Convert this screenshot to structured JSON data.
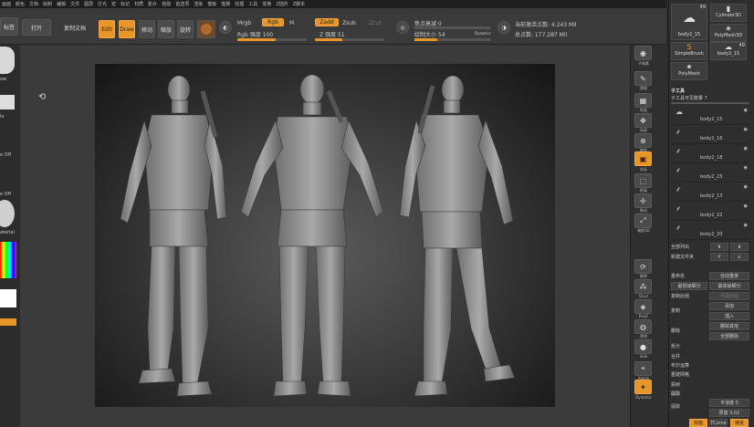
{
  "menu": [
    "画面",
    "颜色",
    "文档",
    "绘制",
    "编辑",
    "文件",
    "图层",
    "灯光",
    "宏",
    "标记",
    "材质",
    "影片",
    "拾取",
    "首选项",
    "渲染",
    "模板",
    "笔刷",
    "纹理",
    "工具",
    "变换",
    "Z插件",
    "Z脚本"
  ],
  "top": {
    "btn_a": "标签",
    "btn_open": "打开",
    "btn_doc": "复制文档",
    "btn_lightbox": "视图布局",
    "mode_edit": "Edit",
    "mode_draw": "Draw",
    "mode_move": "移动",
    "mode_scale": "缩放",
    "mode_rotate": "旋转",
    "mrgb": "Mrgb",
    "rgb": "Rgb",
    "m": "M",
    "rgb_intensity": "Rgb 强度 100",
    "zadd": "Zadd",
    "zsub": "Zsub",
    "zcut": "Zcut",
    "z_intensity": "Z 强度 51",
    "focal_shift": "焦点衰减 0",
    "draw_size": "绘制大小 54",
    "dynamic": "Dynamic",
    "active_points": "当前激活点数: 4.243 Mil",
    "total_points": "总点数: 177.287 Mil",
    "rgb_level": 0.55,
    "z_level": 0.4,
    "draw_level": 0.3
  },
  "left": {
    "label_a": "ow",
    "label_b": "ts",
    "label_c": "e Off",
    "label_d": "e Off",
    "label_e": "aterial"
  },
  "right_tools": [
    {
      "icon": "sphere-icon",
      "label": "子像素"
    },
    {
      "icon": "brush-icon",
      "label": "透视"
    },
    {
      "icon": "grid-icon",
      "label": "地面"
    },
    {
      "icon": "scroll-icon",
      "label": "局部"
    },
    {
      "icon": "zoom-icon",
      "label": "缩放"
    },
    {
      "icon": "actual-icon",
      "label": "实际"
    },
    {
      "icon": "frame-icon",
      "label": "框架"
    },
    {
      "icon": "move-icon",
      "label": "移动"
    },
    {
      "icon": "scale-icon",
      "label": "缩放3D"
    },
    {
      "icon": "rotate-icon",
      "label": "旋转"
    },
    {
      "icon": "line-icon",
      "label": "Qxyz"
    },
    {
      "icon": "poly-icon",
      "label": "PolyF"
    },
    {
      "icon": "transp-icon",
      "label": "透明"
    },
    {
      "icon": "solo-icon",
      "label": "Solo"
    },
    {
      "icon": "xpose-icon",
      "label": "Xpose"
    },
    {
      "icon": "dyn-icon",
      "label": "Dynamic"
    }
  ],
  "tray": {
    "thumbs": [
      {
        "label": "body2_15",
        "count": "49"
      },
      {
        "label": "Cylinder3D"
      },
      {
        "label": "PolyMesh3D"
      },
      {
        "label": "SimpleBrush"
      },
      {
        "label": "body2_15",
        "count": "49"
      },
      {
        "label": "PolyMesh"
      }
    ],
    "subtool_title": "子工具",
    "subtool_count": "子工具可见数量 7",
    "subtools": [
      "body2_15",
      "body2_16",
      "body2_18",
      "body2_23",
      "body2_13",
      "body2_22",
      "body2_20"
    ],
    "all_list": "全部列出",
    "new_folder": "新建文件夹",
    "ops": [
      [
        "重命名",
        "自动重排"
      ],
      [
        "最低级细分",
        "最高级细分"
      ],
      [
        "复制此组",
        "可视此组"
      ],
      [
        "复制",
        "添加"
      ],
      [
        "",
        "插入"
      ],
      [
        "删除",
        "删除其他"
      ],
      [
        "",
        "全部删除"
      ]
    ],
    "sections": [
      "拆分",
      "合并",
      "布尔运算",
      "重建网格",
      "投射",
      "提取"
    ],
    "extract_label": "提取",
    "smooth": "平滑度 5",
    "thickness": "厚度 0.02",
    "bottom_a": "双面",
    "bottom_b": "TCorne",
    "bottom_c": "接受"
  }
}
